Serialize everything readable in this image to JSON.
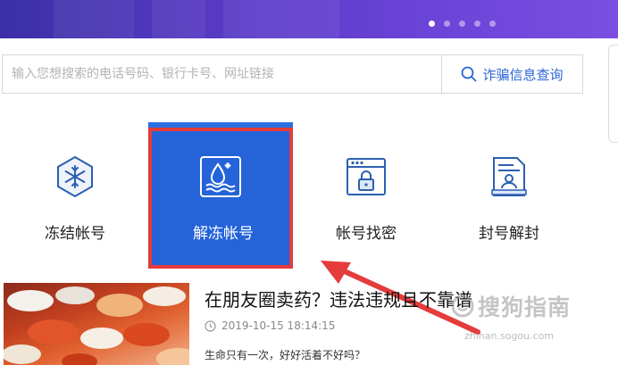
{
  "banner": {
    "colors": {
      "start": "#3b2fa6",
      "end": "#7a4ee0"
    },
    "carousel": {
      "count": 5,
      "active_index": 0
    }
  },
  "search": {
    "placeholder": "输入您想搜索的电话号码、银行卡号、网址链接",
    "value": "",
    "button_label": "诈骗信息查询",
    "button_icon": "search-icon"
  },
  "tiles": [
    {
      "label": "冻结帐号",
      "icon": "snowflake-hexagon-icon",
      "selected": false
    },
    {
      "label": "解冻帐号",
      "icon": "thaw-droplet-icon",
      "selected": true
    },
    {
      "label": "帐号找密",
      "icon": "browser-lock-icon",
      "selected": false
    },
    {
      "label": "封号解封",
      "icon": "document-user-icon",
      "selected": false
    }
  ],
  "colors": {
    "accent": "#2563d9",
    "highlight_border": "#e53b3b",
    "annotation_arrow": "#e53b3b",
    "icon_blue": "#2b5fb0"
  },
  "news": {
    "title": "在朋友圈卖药？违法违规且不靠谱",
    "date": "2019-10-15 18:14:15",
    "summary": "生命只有一次，好好活着不好吗？",
    "thumbnail": "pills-photo"
  },
  "watermark": {
    "text": "搜狗指南",
    "url": "zhinan.sogou.com"
  }
}
